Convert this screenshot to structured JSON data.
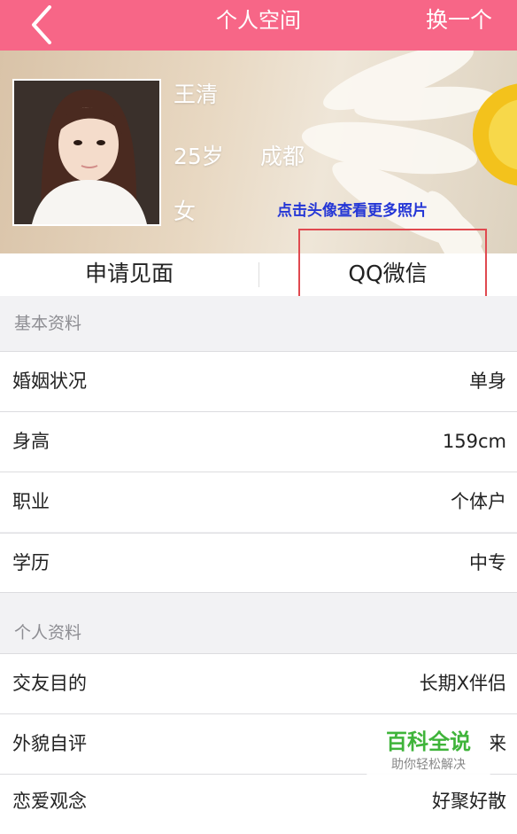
{
  "nav": {
    "title": "个人空间",
    "right_label": "换一个",
    "back_icon": "chevron-left-icon"
  },
  "profile": {
    "name": "王清",
    "age": "25岁",
    "city": "成都",
    "gender": "女",
    "more_photos_link": "点击头像查看更多照片"
  },
  "actions": {
    "meet_label": "申请见面",
    "qq_label": "QQ微信"
  },
  "basic": {
    "header": "基本资料",
    "rows": [
      {
        "label": "婚姻状况",
        "value": "单身"
      },
      {
        "label": "身高",
        "value": "159cm"
      },
      {
        "label": "职业",
        "value": "个体户"
      },
      {
        "label": "学历",
        "value": "中专"
      }
    ]
  },
  "personal": {
    "header": "个人资料",
    "rows": [
      {
        "label": "交友目的",
        "value": "长期X伴侣"
      },
      {
        "label": "外貌自评",
        "value": "来"
      },
      {
        "label": "恋爱观念",
        "value": "好聚好散"
      }
    ]
  },
  "watermark": {
    "title": "百科全说",
    "subtitle": "助你轻松解决"
  },
  "colors": {
    "nav_bg": "#f76687",
    "link": "#2436d6",
    "highlight": "#e0494f"
  }
}
